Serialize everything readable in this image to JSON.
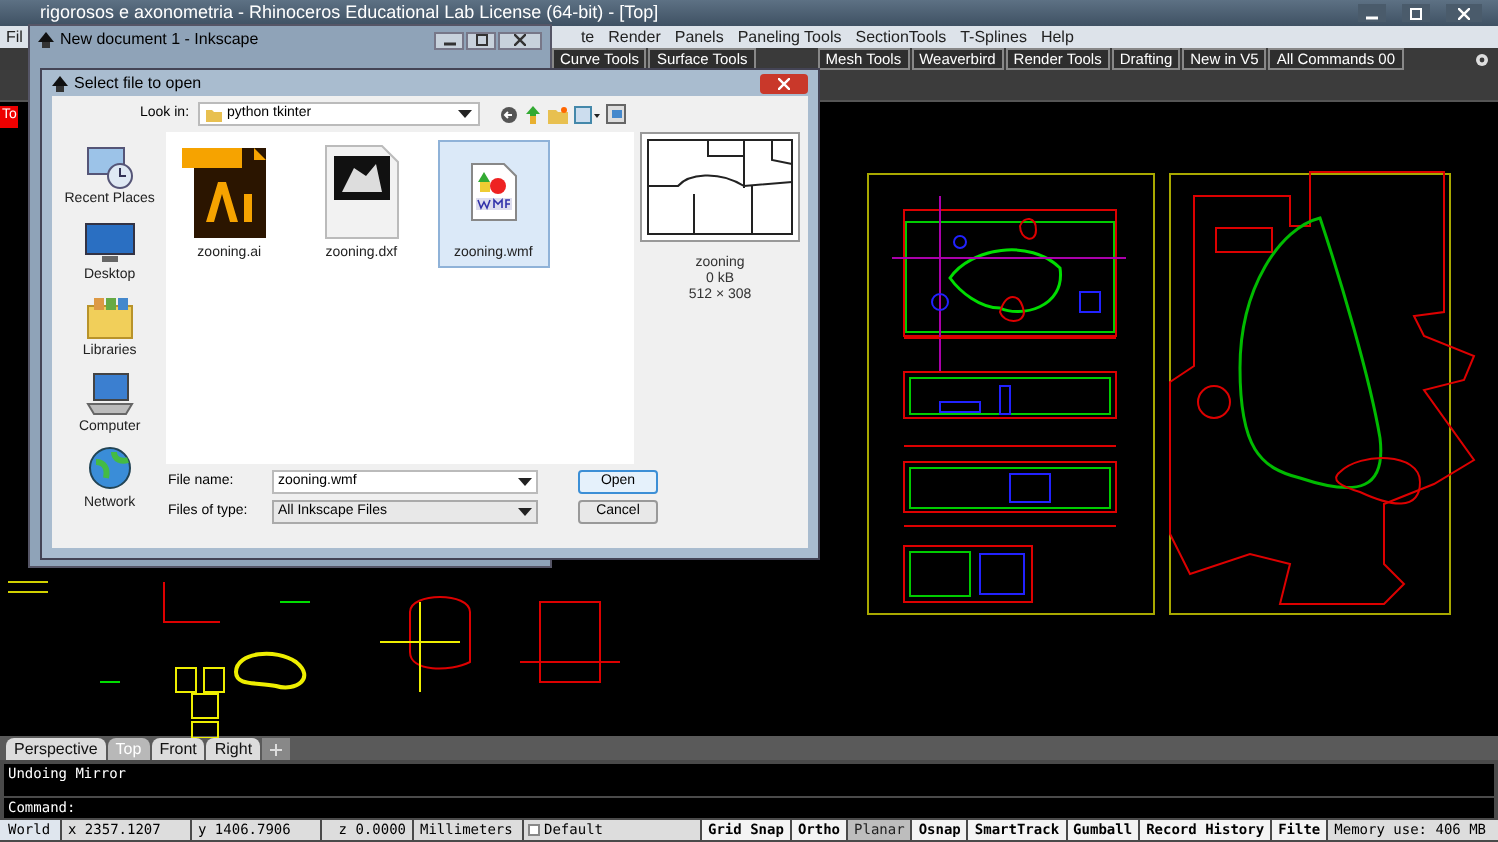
{
  "window": {
    "title": "rigorosos e axonometria - Rhinoceros Educational Lab License (64-bit) - [Top]"
  },
  "menu_left": [
    "Fil"
  ],
  "menu": [
    "te",
    "Render",
    "Panels",
    "Paneling Tools",
    "SectionTools",
    "T-Splines",
    "Help"
  ],
  "toolbar_tabs": [
    "Curve Tools",
    "Surface Tools",
    "Mesh Tools",
    "Weaverbird",
    "Render Tools",
    "Drafting",
    "New in V5",
    "All Commands 00"
  ],
  "viewport": {
    "label": "To"
  },
  "viewport_tabs": [
    {
      "label": "Perspective",
      "selected": false
    },
    {
      "label": "Top",
      "selected": true
    },
    {
      "label": "Front",
      "selected": false
    },
    {
      "label": "Right",
      "selected": false
    }
  ],
  "command_history": [
    "Undoing Mirror"
  ],
  "command_prompt": "Command:",
  "status_bar": {
    "cplane": "World",
    "x": "x 2357.1207",
    "y": "y 1406.7906",
    "z": "z 0.0000",
    "units": "Millimeters",
    "layer": "Default",
    "toggles": [
      {
        "label": "Grid Snap",
        "on": true
      },
      {
        "label": "Ortho",
        "on": true
      },
      {
        "label": "Planar",
        "on": false
      },
      {
        "label": "Osnap",
        "on": true
      },
      {
        "label": "SmartTrack",
        "on": true
      },
      {
        "label": "Gumball",
        "on": true
      },
      {
        "label": "Record History",
        "on": true
      },
      {
        "label": "Filte",
        "on": true
      }
    ],
    "memory": "Memory use: 406 MB"
  },
  "inkscape_window": {
    "title": "New document 1 - Inkscape"
  },
  "dialog": {
    "title": "Select file to open",
    "look_in_label": "Look in:",
    "look_in": "python tkinter",
    "places": [
      {
        "label": "Recent Places",
        "kind": "recent"
      },
      {
        "label": "Desktop",
        "kind": "desktop"
      },
      {
        "label": "Libraries",
        "kind": "libraries"
      },
      {
        "label": "Computer",
        "kind": "computer"
      },
      {
        "label": "Network",
        "kind": "network"
      }
    ],
    "files": [
      {
        "name": "zooning.ai",
        "kind": "ai",
        "selected": false
      },
      {
        "name": "zooning.dxf",
        "kind": "dxf",
        "selected": false
      },
      {
        "name": "zooning.wmf",
        "kind": "wmf",
        "selected": true
      }
    ],
    "preview": {
      "name": "zooning",
      "size": "0 kB",
      "dimensions": "512 × 308"
    },
    "file_name_label": "File name:",
    "file_name": "zooning.wmf",
    "file_type_label": "Files of type:",
    "file_type": "All Inkscape Files",
    "buttons": [
      "Open",
      "Cancel"
    ]
  }
}
